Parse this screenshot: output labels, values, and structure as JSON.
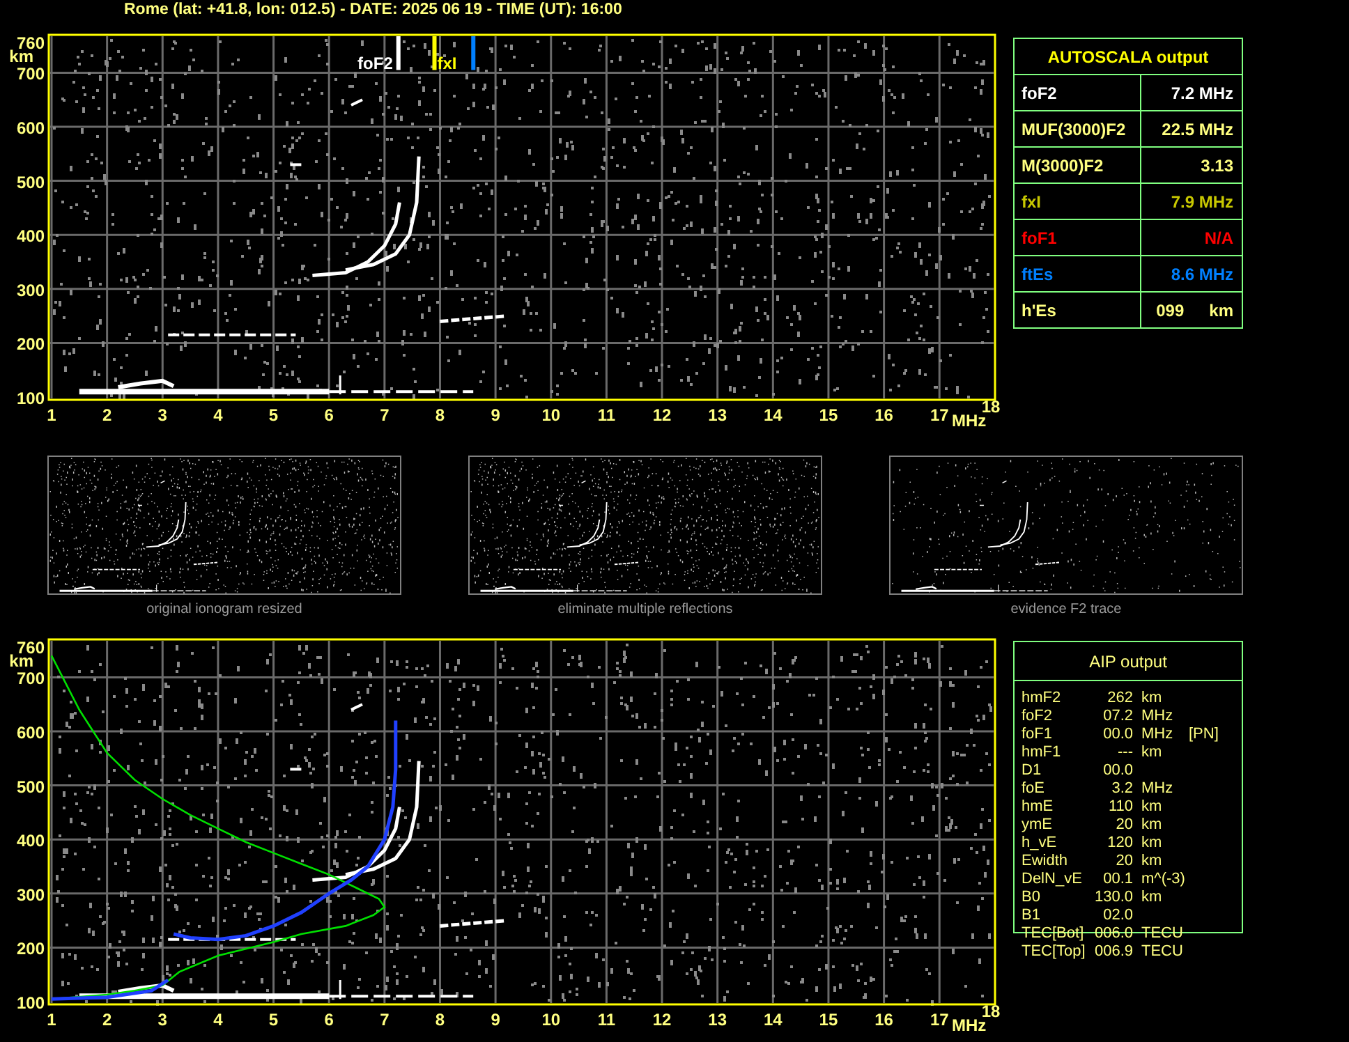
{
  "title": "Rome (lat: +41.8, lon: 012.5) - DATE: 2025 06 19 - TIME (UT): 16:00",
  "ionogram": {
    "y_ticks": [
      "760",
      "700",
      "600",
      "500",
      "400",
      "300",
      "200",
      "100"
    ],
    "y_unit": "km",
    "x_ticks": [
      "1",
      "2",
      "3",
      "4",
      "5",
      "6",
      "7",
      "8",
      "9",
      "10",
      "11",
      "12",
      "13",
      "14",
      "15",
      "16",
      "17",
      "18"
    ],
    "x_unit": "MHz",
    "markers": [
      {
        "kind": "foF2",
        "label": "foF2"
      },
      {
        "kind": "fxI",
        "label": "fxI"
      },
      {
        "kind": "ftEs"
      }
    ]
  },
  "autoscala": {
    "title": "AUTOSCALA output",
    "rows": [
      {
        "name": "foF2",
        "value": "7.2 MHz",
        "color": "#ffffff"
      },
      {
        "name": "MUF(3000)F2",
        "value": "22.5 MHz",
        "color": "#ffff80"
      },
      {
        "name": "M(3000)F2",
        "value": "3.13",
        "color": "#ffff80"
      },
      {
        "name": "fxI",
        "value": "7.9 MHz",
        "color": "#c8c800"
      },
      {
        "name": "foF1",
        "value": "N/A",
        "color": "#ff0000"
      },
      {
        "name": "ftEs",
        "value": "8.6 MHz",
        "color": "#0080ff"
      },
      {
        "name": "h'Es",
        "value": "099",
        "unit": "km",
        "color": "#ffff80"
      }
    ]
  },
  "thumbnails": [
    {
      "caption": "original ionogram resized",
      "kind": "full"
    },
    {
      "caption": "eliminate multiple reflections",
      "kind": "full"
    },
    {
      "caption": "evidence F2 trace",
      "kind": "sparse"
    }
  ],
  "aip_ionogram": {
    "y_ticks": [
      "760",
      "700",
      "600",
      "500",
      "400",
      "300",
      "200",
      "100"
    ],
    "y_unit": "km",
    "x_ticks": [
      "1",
      "2",
      "3",
      "4",
      "5",
      "6",
      "7",
      "8",
      "9",
      "10",
      "11",
      "12",
      "13",
      "14",
      "15",
      "16",
      "17",
      "18"
    ],
    "x_unit": "MHz"
  },
  "aip": {
    "title": "AIP output",
    "rows": [
      {
        "name": "hmF2",
        "value": "262",
        "unit": "km"
      },
      {
        "name": "foF2",
        "value": "07.2",
        "unit": "MHz"
      },
      {
        "name": "foF1",
        "value": "00.0",
        "unit": "MHz",
        "note": "[PN]"
      },
      {
        "name": "hmF1",
        "value": "---",
        "unit": "km"
      },
      {
        "name": "D1",
        "value": "00.0"
      },
      {
        "name": "foE",
        "value": "3.2",
        "unit": "MHz"
      },
      {
        "name": "hmE",
        "value": "110",
        "unit": "km"
      },
      {
        "name": "ymE",
        "value": "20",
        "unit": "km"
      },
      {
        "name": "h_vE",
        "value": "120",
        "unit": "km"
      },
      {
        "name": "Ewidth",
        "value": "20",
        "unit": "km"
      },
      {
        "name": "DelN_vE",
        "value": "00.1",
        "unit": "m^(-3)"
      },
      {
        "name": "B0",
        "value": "130.0",
        "unit": "km"
      },
      {
        "name": "B1",
        "value": "02.0"
      },
      {
        "name": "TEC[Bot]",
        "value": "006.0",
        "unit": "TECU"
      },
      {
        "name": "TEC[Top]",
        "value": "006.9",
        "unit": "TECU"
      }
    ]
  }
}
